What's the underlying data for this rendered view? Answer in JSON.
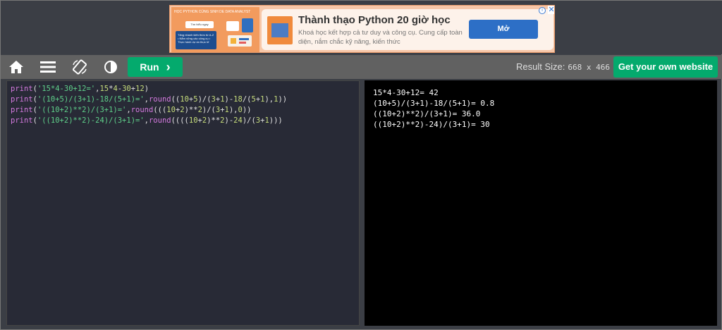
{
  "ad": {
    "thumb_heading": "HỌC PYTHON CÙNG SINH DE DATA ANALYST",
    "thumb_card": "Tìm hiểu ngay",
    "thumb_panel": "Tăng nhanh kiến thức từ A-Z • Nắm vững các công cụ • Thực hành dự án thực tế",
    "title": "Thành thạo Python 20 giờ học",
    "description": "Khoá học kết hợp cả tư duy và công cụ. Cung cấp toàn diện, nắm chắc kỹ năng, kiến thức",
    "button_label": "Mở",
    "info_glyph": "i",
    "close_glyph": "✕"
  },
  "toolbar": {
    "run_label": "Run",
    "run_chevron": "›",
    "result_size_label": "Result Size:",
    "result_size_value": "668 x 466",
    "own_website_label": "Get your own website"
  },
  "icons": {
    "home": "home-icon",
    "menu": "menu-icon",
    "rotate": "rotate-icon",
    "contrast": "contrast-icon"
  },
  "colors": {
    "toolbar_bg": "#616161",
    "accent_green": "#04aa6d",
    "editor_bg": "#282a36",
    "result_bg": "#000000"
  },
  "editor": {
    "lines": [
      "print('15*4-30+12=',15*4-30+12)",
      "print('(10+5)/(3+1)-18/(5+1)=',round((10+5)/(3+1)-18/(5+1),1))",
      "print('((10+2)**2)/(3+1)=',round(((10+2)**2)/(3+1),0))",
      "print('((10+2)**2)-24)/(3+1)=',round((((10+2)**2)-24)/(3+1)))"
    ]
  },
  "result": {
    "lines": [
      "15*4-30+12= 42",
      "(10+5)/(3+1)-18/(5+1)= 0.8",
      "((10+2)**2)/(3+1)= 36.0",
      "((10+2)**2)-24)/(3+1)= 30"
    ]
  }
}
